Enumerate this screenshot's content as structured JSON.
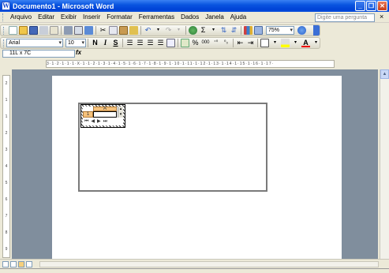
{
  "window": {
    "title": "Documento1 - Microsoft Word"
  },
  "menu": {
    "items": [
      {
        "label": "Arquivo"
      },
      {
        "label": "Editar"
      },
      {
        "label": "Exibir"
      },
      {
        "label": "Inserir"
      },
      {
        "label": "Formatar"
      },
      {
        "label": "Ferramentas"
      },
      {
        "label": "Dados"
      },
      {
        "label": "Janela"
      },
      {
        "label": "Ajuda"
      }
    ],
    "help_placeholder": "Digite uma pergunta"
  },
  "standard_toolbar": {
    "zoom": "75%"
  },
  "formatting_toolbar": {
    "font": "Arial",
    "size": "10",
    "bold": "N",
    "italic": "I",
    "underline": "S"
  },
  "namebox": {
    "value": "11L x 7C",
    "fx": "fx"
  },
  "embedded_sheet": {
    "column": "A",
    "row": "1"
  },
  "icons": [
    "new-icon",
    "open-icon",
    "save-icon",
    "permission-icon",
    "email-icon",
    "print-icon",
    "print-preview-icon",
    "spelling-icon",
    "cut-icon",
    "copy-icon",
    "paste-icon",
    "format-painter-icon",
    "undo-icon",
    "redo-icon",
    "hyperlink-icon",
    "autosum-icon",
    "sort-asc-icon",
    "sort-desc-icon",
    "chart-wizard-icon",
    "drawing-icon",
    "help-icon"
  ],
  "colors": {
    "titlebar": "#0a55e0",
    "workspace": "#808e9d",
    "sheet_header": "#f6c27c"
  }
}
